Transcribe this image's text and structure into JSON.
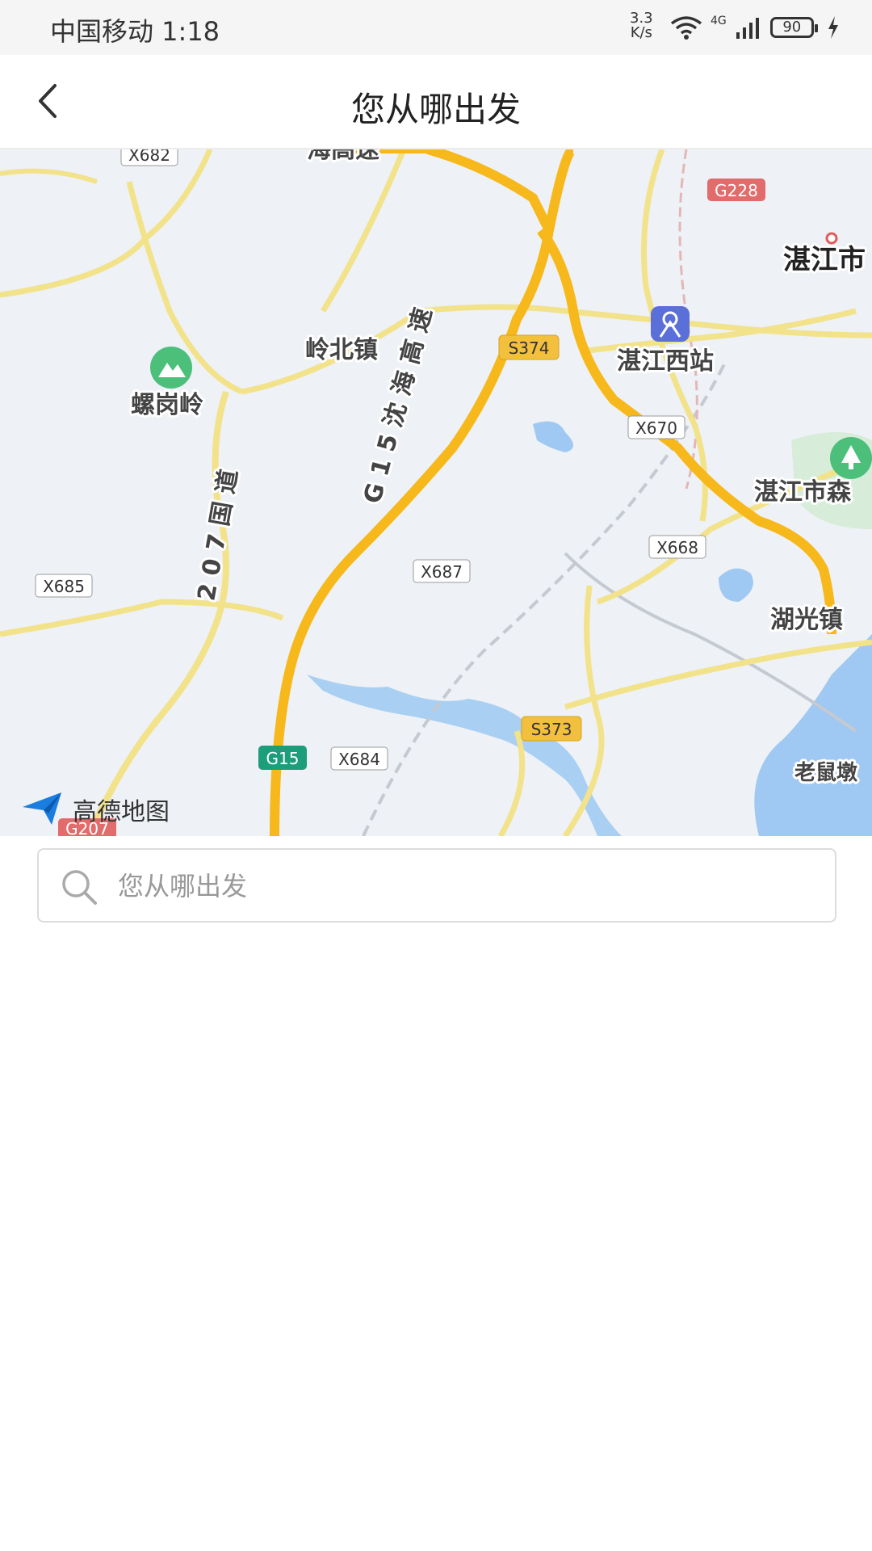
{
  "status_bar": {
    "carrier_time": "中国移动 1:18",
    "net_speed_value": "3.3",
    "net_speed_unit": "K/s",
    "network_type": "4G",
    "battery": "90"
  },
  "header": {
    "title": "您从哪出发"
  },
  "map": {
    "brand": "高德地图",
    "labels": {
      "lingbei": "岭北镇",
      "luogangling": "螺岗岭",
      "zhanjiang_west": "湛江西站",
      "zhanjiang_city": "湛江市",
      "zhanjiang_forest": "湛江市森",
      "huguang": "湖光镇",
      "laoshu": "老鼠墩",
      "g15_vertical": "G 1 5 沈 海 高 速",
      "g207_vertical": "2 0 7 国 道",
      "top_highway": "海高速"
    },
    "shields": {
      "x682": "X682",
      "g228": "G228",
      "s374": "S374",
      "x670": "X670",
      "x668": "X668",
      "x687": "X687",
      "x685": "X685",
      "s373": "S373",
      "g15": "G15",
      "x684": "X684",
      "g207": "G207"
    }
  },
  "search": {
    "placeholder": "您从哪出发"
  }
}
